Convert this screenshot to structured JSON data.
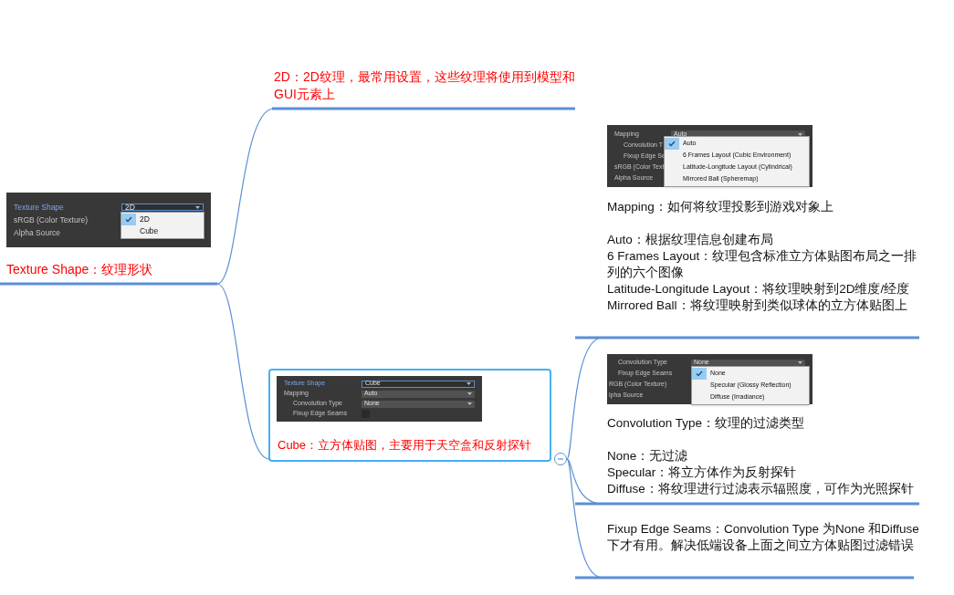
{
  "root": {
    "label": "Texture Shape：纹理形状",
    "panel": {
      "rows": [
        {
          "label": "Texture Shape",
          "kind": "dropdown",
          "value": "2D",
          "highlighted": true,
          "indent": false
        },
        {
          "label": "sRGB (Color Texture)",
          "kind": "plain",
          "highlighted": false,
          "indent": false
        },
        {
          "label": "Alpha Source",
          "kind": "plain",
          "highlighted": false,
          "indent": false
        }
      ],
      "menu": [
        {
          "label": "2D",
          "selected": true
        },
        {
          "label": "Cube",
          "selected": false
        }
      ]
    },
    "children": [
      {
        "label": "2D：2D纹理，最常用设置，这些纹理将使用到模型和GUI元素上",
        "selected": false
      },
      {
        "label": "Cube：立方体贴图，主要用于天空盒和反射探针",
        "selected": true,
        "expanded": true,
        "panel": {
          "rows": [
            {
              "label": "Texture Shape",
              "kind": "dropdown",
              "value": "Cube",
              "highlighted": true,
              "indent": false
            },
            {
              "label": "Mapping",
              "kind": "dropdown",
              "value": "Auto",
              "highlighted": false,
              "indent": false
            },
            {
              "label": "Convolution Type",
              "kind": "dropdown",
              "value": "None",
              "highlighted": false,
              "indent": true
            },
            {
              "label": "Fixup Edge Seams",
              "kind": "checkbox",
              "checked": false,
              "highlighted": false,
              "indent": true
            }
          ]
        },
        "children": [
          {
            "panel": {
              "rows": [
                {
                  "label": "Mapping",
                  "kind": "dropdown",
                  "value": "Auto",
                  "highlighted": false,
                  "indent": false
                },
                {
                  "label": "Convolution T",
                  "kind": "plain",
                  "highlighted": false,
                  "indent": true
                },
                {
                  "label": "Fixup Edge Se",
                  "kind": "plain",
                  "highlighted": false,
                  "indent": true
                },
                {
                  "label": "sRGB (Color Text",
                  "kind": "plain",
                  "highlighted": false,
                  "indent": false
                },
                {
                  "label": "Alpha Source",
                  "kind": "plain",
                  "highlighted": false,
                  "indent": false
                }
              ],
              "menu": [
                {
                  "label": "Auto",
                  "selected": true
                },
                {
                  "label": "6 Frames Layout (Cubic Environment)",
                  "selected": false
                },
                {
                  "label": "Latitude-Longitude Layout (Cylindrical)",
                  "selected": false
                },
                {
                  "label": "Mirrored Ball (Spheremap)",
                  "selected": false
                }
              ]
            },
            "title": "Mapping：如何将纹理投影到游戏对象上",
            "lines": [
              "Auto：根据纹理信息创建布局",
              "6 Frames Layout：纹理包含标准立方体贴图布局之一排列的六个图像",
              "Latitude-Longitude Layout：将纹理映射到2D维度/经度",
              "Mirrored Ball：将纹理映射到类似球体的立方体贴图上"
            ]
          },
          {
            "panel": {
              "rows": [
                {
                  "label": "Convolution Type",
                  "kind": "dropdown",
                  "value": "None",
                  "highlighted": false,
                  "indent": true
                },
                {
                  "label": "Fixup Edge Seams",
                  "kind": "plain",
                  "highlighted": false,
                  "indent": true
                },
                {
                  "label": "RGB (Color Texture)",
                  "kind": "plain",
                  "highlighted": false,
                  "indent": false
                },
                {
                  "label": "lpha Source",
                  "kind": "plain",
                  "highlighted": false,
                  "indent": false
                }
              ],
              "menu": [
                {
                  "label": "None",
                  "selected": true
                },
                {
                  "label": "Specular (Glossy Reflection)",
                  "selected": false
                },
                {
                  "label": "Diffuse (Irradiance)",
                  "selected": false
                }
              ]
            },
            "title": "Convolution Type：纹理的过滤类型",
            "lines": [
              "None：无过滤",
              "Specular：将立方体作为反射探针",
              "Diffuse：将纹理进行过滤表示辐照度，可作为光照探针"
            ]
          },
          {
            "title": "Fixup Edge Seams：Convolution Type 为None 和Diffuse下才有用。解决低端设备上面之间立方体贴图过滤错误"
          }
        ]
      }
    ]
  }
}
